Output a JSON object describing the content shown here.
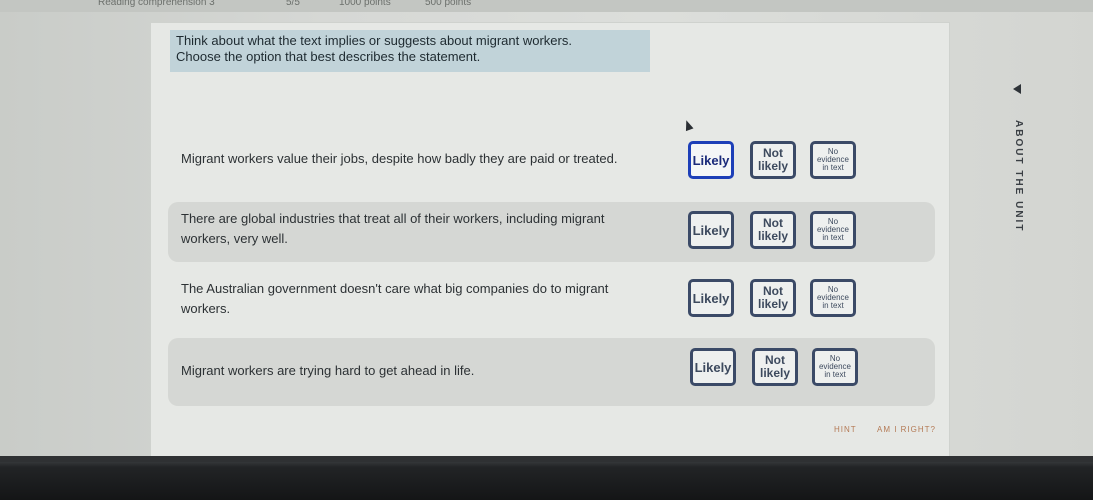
{
  "topbar": {
    "tab_title": "Reading comprehension 3",
    "progress": "5/5",
    "points_total": "1000 points",
    "points_earned": "500 points"
  },
  "instructions": {
    "line1": "Think about what the text implies or suggests about migrant workers.",
    "line2": "Choose the option that best describes the statement."
  },
  "options": {
    "likely": "Likely",
    "not_likely_line1": "Not",
    "not_likely_line2": "likely",
    "no_evidence_line1": "No",
    "no_evidence_line2": "evidence",
    "no_evidence_line3": "in text"
  },
  "statements": [
    {
      "line1": "Migrant workers value their jobs, despite how badly they are paid or treated.",
      "line2": "",
      "selected": "Likely"
    },
    {
      "line1": "There are global industries that treat all of their workers, including migrant",
      "line2": "workers, very well.",
      "selected": ""
    },
    {
      "line1": "The Australian government doesn't care what big companies do to migrant",
      "line2": "workers.",
      "selected": ""
    },
    {
      "line1": "Migrant workers are trying hard to get ahead in life.",
      "line2": "",
      "selected": ""
    }
  ],
  "side_nav": {
    "label": "ABOUT THE UNIT",
    "icon": "caret-left-icon"
  },
  "buttons": {
    "hint": "HINT",
    "check": "AM I RIGHT?"
  },
  "colors": {
    "selected_border": "#1d3fb8",
    "option_border": "#3b4a67",
    "instruction_bg": "#c1d3d9",
    "button_text": "#b47a55"
  }
}
